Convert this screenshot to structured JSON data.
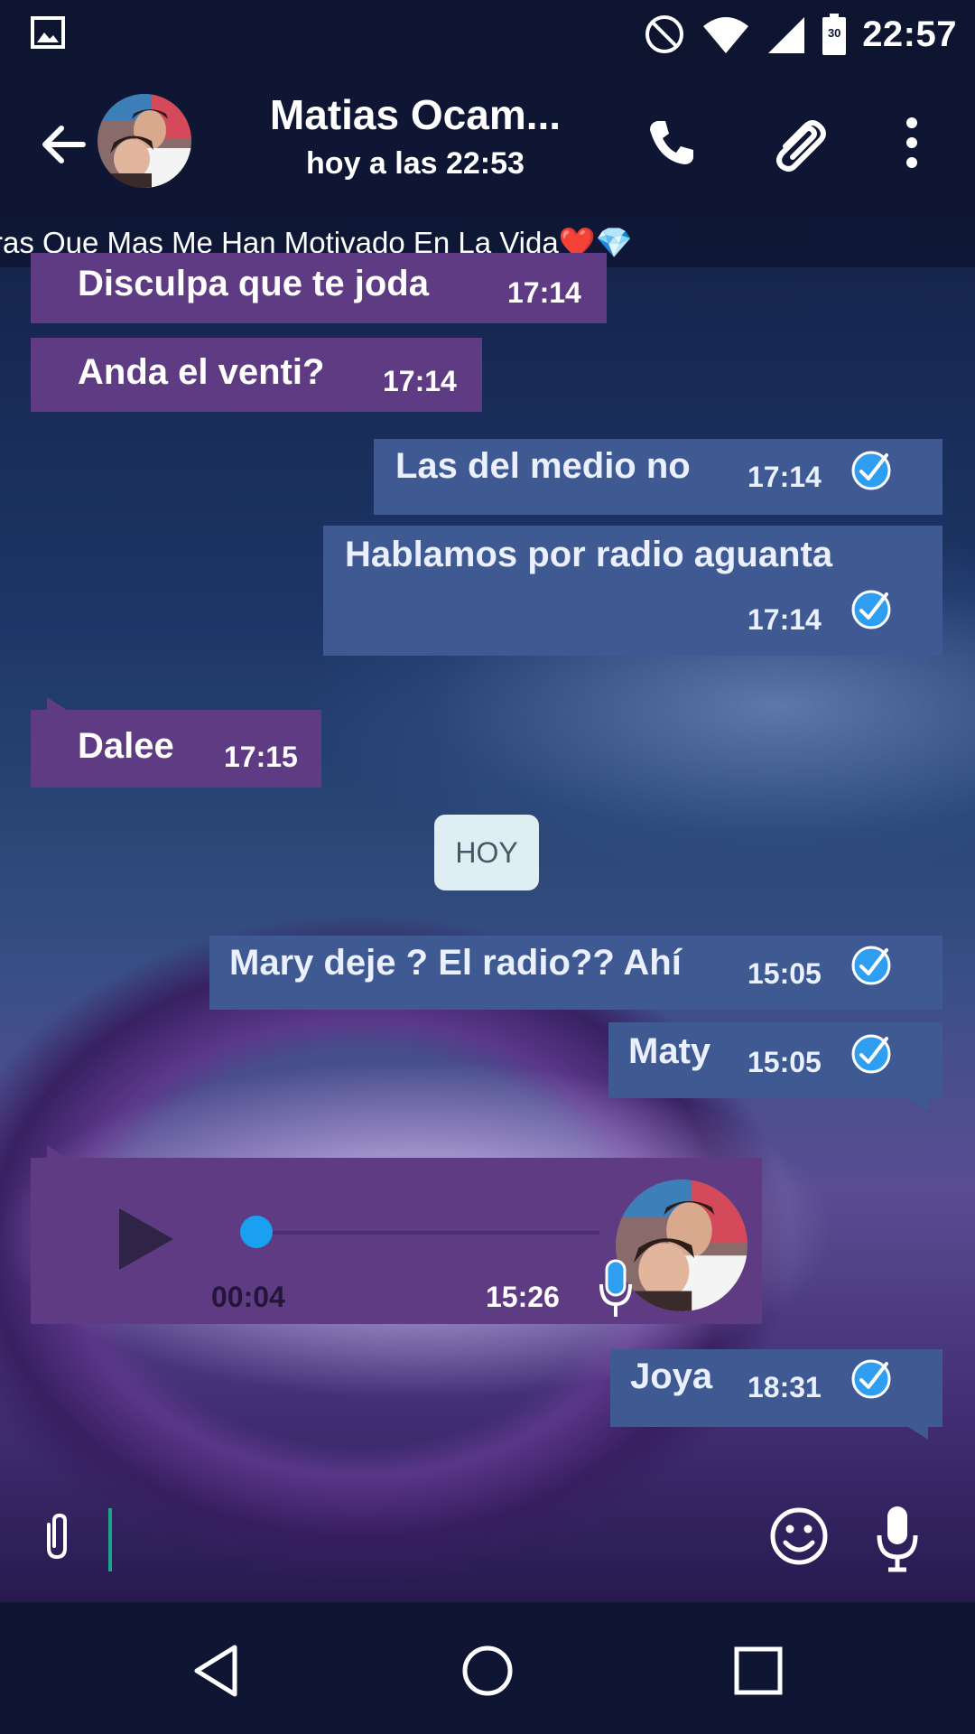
{
  "status_bar": {
    "time": "22:57",
    "battery_level": "30",
    "icons": [
      "image-icon",
      "do-not-disturb-icon",
      "wifi-icon",
      "cell-signal-icon",
      "battery-icon"
    ]
  },
  "header": {
    "title": "Matias Ocam...",
    "subtitle": "hoy a las 22:53",
    "icons": [
      "back-arrow-icon",
      "avatar",
      "phone-icon",
      "paperclip-icon",
      "more-vert-icon"
    ]
  },
  "pinned": {
    "text": "ras Que Mas Me Han Motivado En La Vida❤️💎"
  },
  "messages": [
    {
      "dir": "in",
      "text": "Disculpa que te joda",
      "time": "17:14"
    },
    {
      "dir": "in",
      "text": "Anda el venti?",
      "time": "17:14"
    },
    {
      "dir": "out",
      "text": "Las del medio no",
      "time": "17:14",
      "read": true
    },
    {
      "dir": "out",
      "text": "Hablamos por radio aguanta",
      "time": "17:14",
      "read": true
    },
    {
      "dir": "in",
      "text": "Dalee",
      "time": "17:15"
    },
    {
      "dir": "out",
      "text": "Mary deje ? El radio?? Ahí",
      "time": "15:05",
      "read": true
    },
    {
      "dir": "out",
      "text": "Maty",
      "time": "15:05",
      "read": true
    },
    {
      "dir": "out",
      "text": "Joya",
      "time": "18:31",
      "read": true
    }
  ],
  "date_separator": "HOY",
  "voice_message": {
    "duration": "00:04",
    "time": "15:26",
    "progress": 0.0
  },
  "colors": {
    "incoming_bubble": "#5e3b82",
    "outgoing_bubble": "#3f5a92",
    "read_tick": "#2f9df0",
    "header": "#0f1633"
  }
}
